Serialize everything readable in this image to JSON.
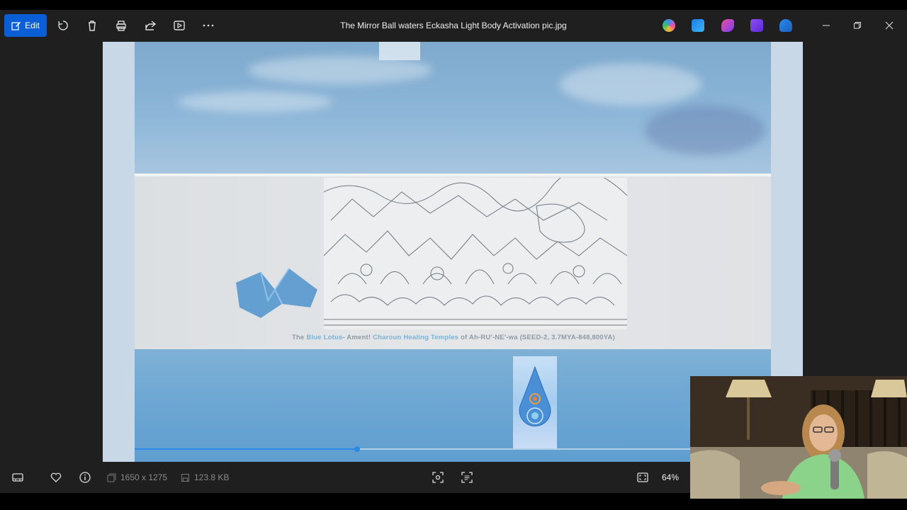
{
  "toolbar": {
    "edit_label": "Edit",
    "window_title": "The Mirror Ball waters Eckasha Light Body Activation pic.jpg"
  },
  "image": {
    "caption_parts": [
      "The ",
      "Blue Lotus",
      "- Ament! ",
      "Charoun Healing Temples",
      " of Ah-RU'-NE'-wa (SEED-2, 3.7MYA-848,800YA)"
    ],
    "playback_progress": 0.35
  },
  "status": {
    "dimensions": "1650 x 1275",
    "file_size": "123.8 KB",
    "zoom": "64%"
  },
  "icons": {
    "edit": "edit-icon",
    "rotate": "rotate-icon",
    "delete": "trash-icon",
    "print": "print-icon",
    "share": "share-icon",
    "slideshow": "slideshow-icon",
    "more": "more-icon",
    "filmstrip": "filmstrip-icon",
    "favorite": "heart-icon",
    "info": "info-icon",
    "fit": "fit-to-window-icon"
  },
  "colors": {
    "accent": "#0a5fd6",
    "toolbar_bg": "#1f1f1f",
    "progress": "#2a8ae8"
  }
}
